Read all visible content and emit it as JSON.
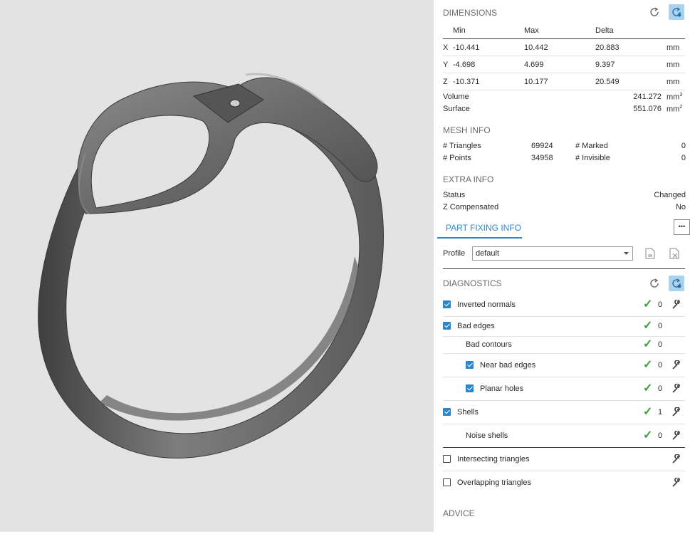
{
  "dimensions": {
    "title": "DIMENSIONS",
    "headers": [
      "Min",
      "Max",
      "Delta"
    ],
    "rows": [
      {
        "axis": "X",
        "min": "-10.441",
        "max": "10.442",
        "delta": "20.883",
        "unit": "mm"
      },
      {
        "axis": "Y",
        "min": "-4.698",
        "max": "4.699",
        "delta": "9.397",
        "unit": "mm"
      },
      {
        "axis": "Z",
        "min": "-10.371",
        "max": "10.177",
        "delta": "20.549",
        "unit": "mm"
      }
    ],
    "volume": {
      "label": "Volume",
      "value": "241.272",
      "unit": "mm",
      "sup": "3"
    },
    "surface": {
      "label": "Surface",
      "value": "551.076",
      "unit": "mm",
      "sup": "2"
    }
  },
  "mesh_info": {
    "title": "MESH INFO",
    "triangles_label": "# Triangles",
    "triangles": "69924",
    "marked_label": "# Marked",
    "marked": "0",
    "points_label": "# Points",
    "points": "34958",
    "invisible_label": "# Invisible",
    "invisible": "0"
  },
  "extra_info": {
    "title": "EXTRA INFO",
    "status_label": "Status",
    "status": "Changed",
    "zcomp_label": "Z Compensated",
    "zcomp": "No"
  },
  "part_fixing": {
    "tab": "PART FIXING INFO",
    "more": "•••",
    "profile_label": "Profile",
    "profile_value": "default"
  },
  "diagnostics": {
    "title": "DIAGNOSTICS",
    "items": [
      {
        "label": "Inverted normals",
        "count": "0"
      },
      {
        "label": "Bad edges",
        "count": "0"
      },
      {
        "label": "Bad contours",
        "count": "0"
      },
      {
        "label": "Near bad edges",
        "count": "0"
      },
      {
        "label": "Planar holes",
        "count": "0"
      },
      {
        "label": "Shells",
        "count": "1"
      },
      {
        "label": "Noise shells",
        "count": "0"
      },
      {
        "label": "Intersecting triangles"
      },
      {
        "label": "Overlapping triangles"
      }
    ]
  },
  "advice": {
    "title": "ADVICE"
  },
  "colors": {
    "accent": "#2e86c9",
    "ok": "#3aa23a",
    "active_button": "#a9d2ef",
    "viewport_bg": "#e3e3e3"
  },
  "icons": [
    "refresh-icon",
    "refresh-auto-icon",
    "checkmark-icon",
    "wrench-icon",
    "dropdown-arrow-icon",
    "save-profile-icon",
    "delete-profile-icon"
  ]
}
